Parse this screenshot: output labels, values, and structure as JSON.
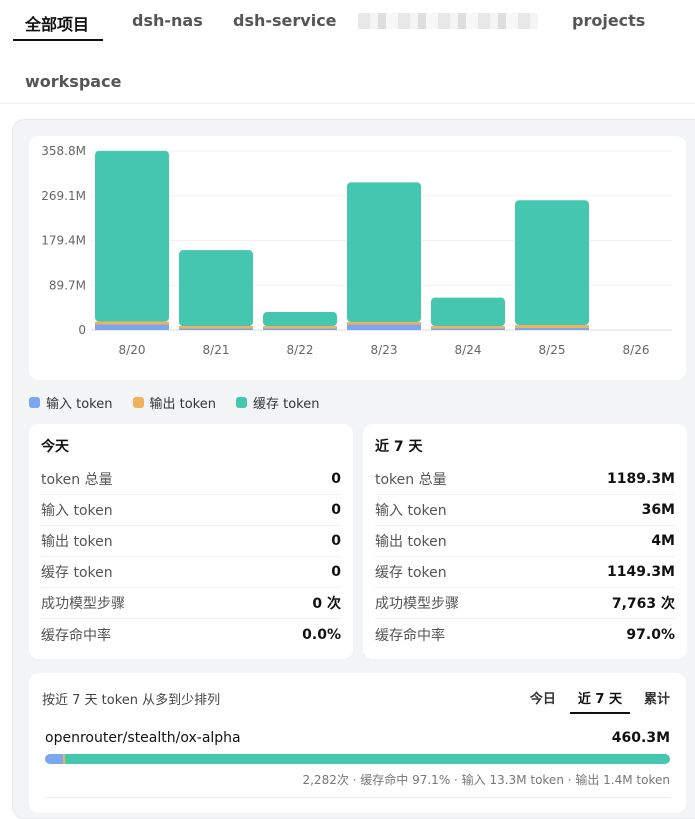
{
  "tabs": {
    "items": [
      {
        "label": "全部项目",
        "active": true
      },
      {
        "label": "dsh-nas"
      },
      {
        "label": "dsh-service"
      },
      {
        "label": ""
      },
      {
        "label": "projects"
      },
      {
        "label": "workspace"
      }
    ]
  },
  "colors": {
    "input": "#7ba7f1",
    "output": "#f0b25a",
    "cache": "#45c6ae"
  },
  "chart_data": {
    "type": "bar",
    "stacked": true,
    "categories": [
      "8/20",
      "8/21",
      "8/22",
      "8/23",
      "8/24",
      "8/25",
      "8/26"
    ],
    "y_ticks": [
      "0",
      "89.7M",
      "179.4M",
      "269.1M",
      "358.8M"
    ],
    "ylim": [
      0,
      358.8
    ],
    "grid": true,
    "series": [
      {
        "name": "输入 token",
        "color": "#7ba7f1",
        "values": [
          11,
          3,
          3,
          11,
          3,
          4,
          0
        ]
      },
      {
        "name": "输出 token",
        "color": "#f0b25a",
        "values": [
          6,
          5,
          5,
          5,
          5,
          6,
          0
        ]
      },
      {
        "name": "缓存 token",
        "color": "#45c6ae",
        "values": [
          342,
          152,
          28,
          280,
          57,
          250,
          0
        ]
      }
    ]
  },
  "legend": {
    "items": [
      {
        "label": "输入 token",
        "color": "#7ba7f1"
      },
      {
        "label": "输出 token",
        "color": "#f0b25a"
      },
      {
        "label": "缓存 token",
        "color": "#45c6ae"
      }
    ]
  },
  "today": {
    "title": "今天",
    "rows": [
      {
        "label": "token 总量",
        "value": "0"
      },
      {
        "label": "输入 token",
        "value": "0"
      },
      {
        "label": "输出 token",
        "value": "0"
      },
      {
        "label": "缓存 token",
        "value": "0"
      },
      {
        "label": "成功模型步骤",
        "value": "0 次"
      },
      {
        "label": "缓存命中率",
        "value": "0.0%"
      }
    ]
  },
  "week": {
    "title": "近 7 天",
    "rows": [
      {
        "label": "token 总量",
        "value": "1189.3M"
      },
      {
        "label": "输入 token",
        "value": "36M"
      },
      {
        "label": "输出 token",
        "value": "4M"
      },
      {
        "label": "缓存 token",
        "value": "1149.3M"
      },
      {
        "label": "成功模型步骤",
        "value": "7,763 次"
      },
      {
        "label": "缓存命中率",
        "value": "97.0%"
      }
    ]
  },
  "ranking": {
    "header": "按近 7 天 token 从多到少排列",
    "tabs": [
      {
        "label": "今日"
      },
      {
        "label": "近 7 天",
        "active": true
      },
      {
        "label": "累计"
      }
    ],
    "items": [
      {
        "model": "openrouter/stealth/ox-alpha",
        "total": "460.3M",
        "detail": "2,282次 · 缓存命中 97.1% · 输入 13.3M token · 输出 1.4M token",
        "shares": {
          "input": 0.029,
          "output": 0.003,
          "cache": 0.968
        }
      }
    ]
  }
}
